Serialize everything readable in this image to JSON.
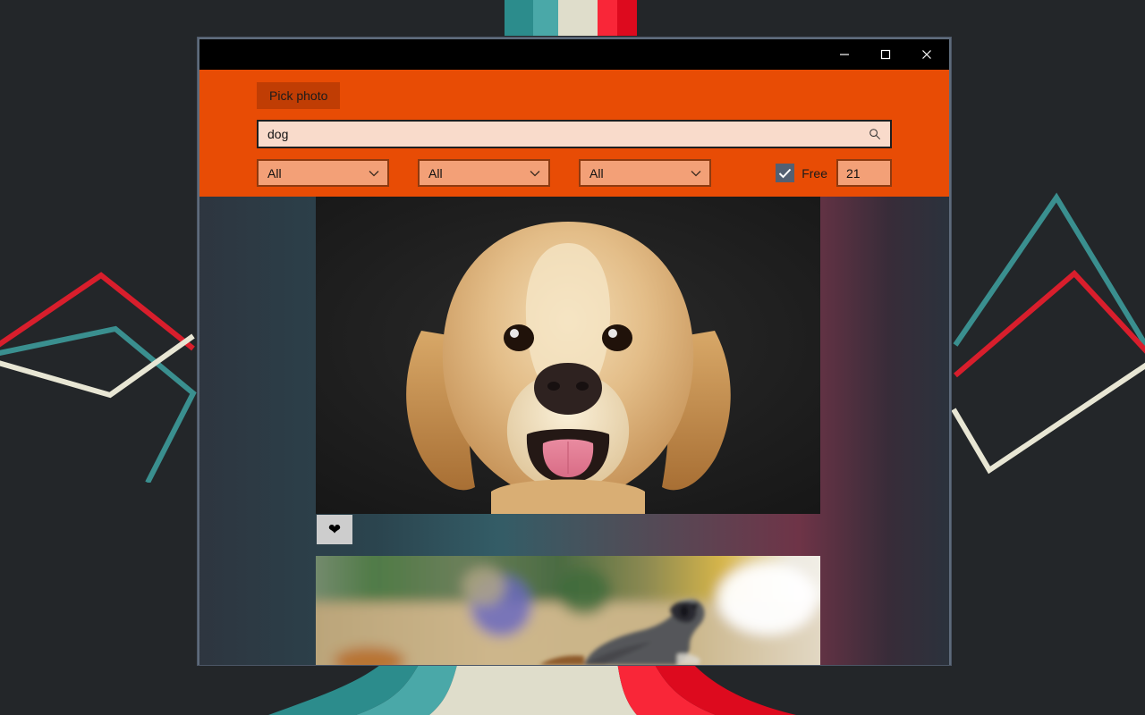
{
  "desktop": {
    "background_color": "#232629",
    "stripe_colors": [
      "#2c8c8c",
      "#4aa8a8",
      "#dfddcb",
      "#f92638",
      "#dd0a1e"
    ],
    "artwork_colors": {
      "red": "#d81e2c",
      "teal": "#3a8f8f",
      "cream": "#e8e6d4"
    }
  },
  "window": {
    "frame_color": "#5e6b7b",
    "titlebar": {
      "background": "#000000",
      "buttons": [
        {
          "name": "minimize",
          "glyph": "minimize-icon"
        },
        {
          "name": "maximize",
          "glyph": "maximize-icon"
        },
        {
          "name": "close",
          "glyph": "close-icon"
        }
      ]
    }
  },
  "header": {
    "background": "#e84c05",
    "pick_photo_label": "Pick photo",
    "pick_photo_color": "#c03d04",
    "search": {
      "value": "dog",
      "placeholder": "Search",
      "icon": "search-icon",
      "background": "#f9dbcb"
    },
    "filters": [
      {
        "name": "filter-1",
        "value": "All"
      },
      {
        "name": "filter-2",
        "value": "All"
      },
      {
        "name": "filter-3",
        "value": "All"
      }
    ],
    "free": {
      "checked": true,
      "label": "Free",
      "checkbox_color": "#536072"
    },
    "count": {
      "value": "21"
    }
  },
  "results": {
    "background": "#2b323c",
    "items": [
      {
        "name": "photo-result-1",
        "alt": "Golden retriever dog portrait on dark background",
        "favorite_icon": "heart-icon",
        "favorite_glyph": "❤"
      },
      {
        "name": "photo-result-2",
        "alt": "Blurred outdoor photo with dog snout"
      }
    ]
  }
}
